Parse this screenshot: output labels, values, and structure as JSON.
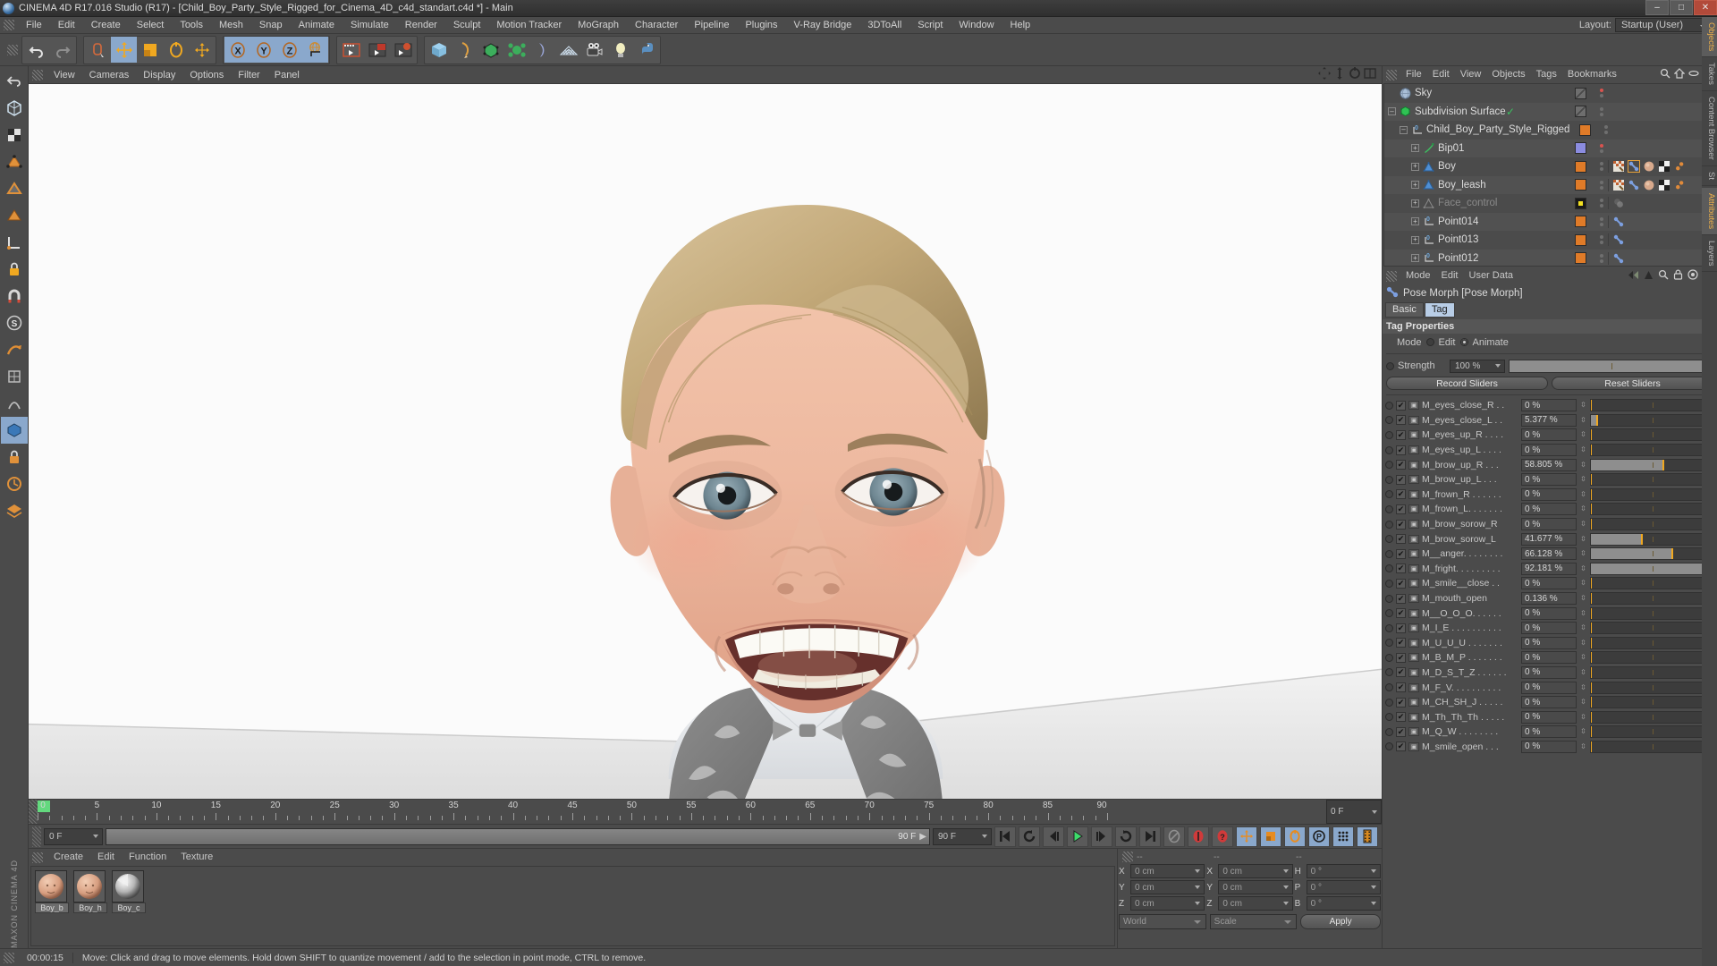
{
  "window": {
    "title": "CINEMA 4D R17.016 Studio (R17) - [Child_Boy_Party_Style_Rigged_for_Cinema_4D_c4d_standart.c4d *] - Main",
    "minimize": "–",
    "maximize": "□",
    "close": "✕"
  },
  "menubar": {
    "items": [
      "File",
      "Edit",
      "Create",
      "Select",
      "Tools",
      "Mesh",
      "Snap",
      "Animate",
      "Simulate",
      "Render",
      "Sculpt",
      "Motion Tracker",
      "MoGraph",
      "Character",
      "Pipeline",
      "Plugins",
      "V-Ray Bridge",
      "3DToAll",
      "Script",
      "Window",
      "Help"
    ],
    "layout_label": "Layout:",
    "layout_value": "Startup (User)"
  },
  "toolbar": {
    "groups": [
      {
        "name": "history",
        "buttons": [
          "undo-icon",
          "redo-icon"
        ]
      },
      {
        "name": "selection",
        "buttons": [
          "live-selection-icon",
          "move-icon",
          "scale-icon",
          "rotate-icon",
          "move-axis-icon"
        ]
      },
      {
        "name": "axis-lock",
        "buttons": [
          "x-axis-icon",
          "y-axis-icon",
          "z-axis-icon",
          "world-coord-icon"
        ]
      },
      {
        "name": "render",
        "buttons": [
          "render-view-icon",
          "render-region-icon",
          "render-settings-icon"
        ]
      },
      {
        "name": "objects",
        "buttons": [
          "cube-icon",
          "spline-pen-icon",
          "nurbs-icon",
          "array-icon",
          "deformer-icon",
          "floor-icon",
          "camera-icon",
          "light-icon",
          "python-icon"
        ]
      }
    ]
  },
  "left_tools": {
    "buttons": [
      "undo-nav-icon",
      "model-mode-icon",
      "texture-mode-icon",
      "points-mode-icon",
      "edges-mode-icon",
      "polygons-mode-icon",
      "axis-mode-icon",
      "lock-axis-icon",
      "magnet-icon",
      "snap-icon",
      "workplane-icon",
      "enable-axis-icon",
      "enable-deform-icon",
      "viewport-solo-icon",
      "render-lock-icon",
      "animation-lock-icon",
      "layer-lock-icon"
    ],
    "brand": "MAXON CINEMA 4D"
  },
  "viewport": {
    "menu": [
      "View",
      "Cameras",
      "Display",
      "Options",
      "Filter",
      "Panel"
    ],
    "nav_icons": [
      "pan-icon",
      "zoom-icon",
      "rotate-icon",
      "maximize-view-icon"
    ],
    "scene_caption": "Child boy character head with Pose Morph facial expression"
  },
  "timeline": {
    "ticks": [
      0,
      5,
      10,
      15,
      20,
      25,
      30,
      35,
      40,
      45,
      50,
      55,
      60,
      65,
      70,
      75,
      80,
      85,
      90
    ],
    "min": 0,
    "max": 90,
    "current_frame_green": 0,
    "end_frame_field": "0 F"
  },
  "transport": {
    "current_frame": "0 F",
    "preview_start": "0 F",
    "preview_end": "90 F",
    "doc_end": "90 F",
    "buttons": [
      "go-to-start-icon",
      "play-backwards-loop-icon",
      "step-back-icon",
      "play-icon",
      "step-forward-icon",
      "loop-icon",
      "go-to-end-icon",
      "autokey-icon",
      "record-icon",
      "keyframe-selection-icon"
    ],
    "modes": [
      "position-key-icon",
      "scale-key-icon",
      "rotation-key-icon",
      "param-key-icon",
      "point-level-anim-icon",
      "timeline-icon"
    ]
  },
  "material_manager": {
    "menu": [
      "Create",
      "Edit",
      "Function",
      "Texture"
    ],
    "materials": [
      {
        "name": "Boy_b",
        "type": "skin"
      },
      {
        "name": "Boy_h",
        "type": "skin"
      },
      {
        "name": "Boy_c",
        "type": "cloth"
      }
    ]
  },
  "coordinates": {
    "headers": [
      "--",
      "--",
      "--"
    ],
    "position": {
      "label_x": "X",
      "label_y": "Y",
      "label_z": "Z",
      "x": "0 cm",
      "y": "0 cm",
      "z": "0 cm"
    },
    "size": {
      "label_x": "X",
      "label_y": "Y",
      "label_z": "Z",
      "x": "0 cm",
      "y": "0 cm",
      "z": "0 cm"
    },
    "rotation": {
      "label_h": "H",
      "label_p": "P",
      "label_b": "B",
      "h": "0 °",
      "p": "0 °",
      "b": "0 °"
    },
    "coord_system": "World",
    "size_mode": "Scale",
    "apply_label": "Apply"
  },
  "object_manager": {
    "menu": [
      "File",
      "Edit",
      "View",
      "Objects",
      "Tags",
      "Bookmarks"
    ],
    "tools": [
      "search-icon",
      "home-icon",
      "filter-icon",
      "add-icon"
    ],
    "rows": [
      {
        "name": "Sky",
        "indent": 0,
        "icon": "sky-sphere-icon",
        "expander": "none",
        "color": "#6f6f6f",
        "swatch": "diagonal",
        "dots": [
          "red",
          "grey"
        ],
        "tags": [],
        "dim": false
      },
      {
        "name": "Subdivision Surface",
        "indent": 0,
        "icon": "subdivision-surface-icon",
        "expander": "minus",
        "color": "#36b24a",
        "swatch": "diagonal",
        "dots": [
          "grey",
          "grey"
        ],
        "check": true,
        "tags": [],
        "dim": false
      },
      {
        "name": "Child_Boy_Party_Style_Rigged",
        "indent": 1,
        "icon": "null-object-icon",
        "expander": "minus",
        "swatch": "#e07b28",
        "dots": [
          "grey",
          "grey"
        ],
        "tags": [],
        "dim": false
      },
      {
        "name": "Bip01",
        "indent": 2,
        "icon": "joint-icon",
        "expander": "plus",
        "swatch": "#8b8ce0",
        "dots": [
          "red",
          "grey"
        ],
        "tags": [],
        "dim": false
      },
      {
        "name": "Boy",
        "indent": 2,
        "icon": "polygon-object-icon",
        "expander": "plus",
        "swatch": "#e07b28",
        "dots": [
          "grey",
          "grey"
        ],
        "tags": [
          "weight-tag-icon",
          "posemorph-tag-icon",
          "texture-tag-icon",
          "uv-tag-icon",
          "selection-tag-icon"
        ],
        "dim": false,
        "tag_selected": 1
      },
      {
        "name": "Boy_leash",
        "indent": 2,
        "icon": "polygon-object-icon",
        "expander": "plus",
        "swatch": "#e07b28",
        "dots": [
          "grey",
          "grey"
        ],
        "tags": [
          "weight-tag-icon",
          "posemorph-tag-icon",
          "texture-tag-icon",
          "uv-tag-icon",
          "selection-tag-icon"
        ],
        "dim": false
      },
      {
        "name": "Face_control",
        "indent": 2,
        "icon": "polygon-object-icon",
        "expander": "plus",
        "swatch": "#f2e021",
        "dots": [
          "grey",
          "grey"
        ],
        "tags": [
          "material-tag-icon"
        ],
        "dim": true
      },
      {
        "name": "Point014",
        "indent": 2,
        "icon": "null-object-icon",
        "expander": "plus",
        "swatch": "#e07b28",
        "dots": [
          "grey",
          "grey"
        ],
        "tags": [
          "posemorph-tag-icon"
        ],
        "dim": false
      },
      {
        "name": "Point013",
        "indent": 2,
        "icon": "null-object-icon",
        "expander": "plus",
        "swatch": "#e07b28",
        "dots": [
          "grey",
          "grey"
        ],
        "tags": [
          "posemorph-tag-icon"
        ],
        "dim": false
      },
      {
        "name": "Point012",
        "indent": 2,
        "icon": "null-object-icon",
        "expander": "plus",
        "swatch": "#e07b28",
        "dots": [
          "grey",
          "grey"
        ],
        "tags": [
          "posemorph-tag-icon"
        ],
        "dim": false
      }
    ]
  },
  "attribute_manager": {
    "menu": [
      "Mode",
      "Edit",
      "User Data"
    ],
    "tools": [
      "back-icon",
      "forward-icon",
      "up-icon",
      "search-icon",
      "lock-icon",
      "target-icon",
      "add-icon"
    ],
    "object_title": "Pose Morph [Pose Morph]",
    "tabs": [
      {
        "label": "Basic",
        "active": false
      },
      {
        "label": "Tag",
        "active": true
      }
    ],
    "section": "Tag Properties",
    "mode_label": "Mode",
    "mode_options": [
      {
        "label": "Edit",
        "active": false
      },
      {
        "label": "Animate",
        "active": true
      }
    ],
    "strength": {
      "label": "Strength",
      "value": "100 %",
      "percent": 100
    },
    "record_label": "Record Sliders",
    "reset_label": "Reset Sliders",
    "sliders": [
      {
        "name": "M_eyes_close_R . .",
        "value": "0 %",
        "percent": 0
      },
      {
        "name": "M_eyes_close_L . .",
        "value": "5.377 %",
        "percent": 5.377
      },
      {
        "name": "M_eyes_up_R . . . .",
        "value": "0 %",
        "percent": 0
      },
      {
        "name": "M_eyes_up_L . . . .",
        "value": "0 %",
        "percent": 0
      },
      {
        "name": "M_brow_up_R . . .",
        "value": "58.805 %",
        "percent": 58.805
      },
      {
        "name": "M_brow_up_L . . .",
        "value": "0 %",
        "percent": 0
      },
      {
        "name": "M_frown_R . . . . . .",
        "value": "0 %",
        "percent": 0
      },
      {
        "name": "M_frown_L. . . . . . .",
        "value": "0 %",
        "percent": 0
      },
      {
        "name": "M_brow_sorow_R",
        "value": "0 %",
        "percent": 0
      },
      {
        "name": "M_brow_sorow_L",
        "value": "41.677 %",
        "percent": 41.677
      },
      {
        "name": "M__anger. . . . . . . .",
        "value": "66.128 %",
        "percent": 66.128
      },
      {
        "name": "M_fright. . . . . . . . .",
        "value": "92.181 %",
        "percent": 92.181
      },
      {
        "name": "M_smile__close . .",
        "value": "0 %",
        "percent": 0
      },
      {
        "name": "M_mouth_open",
        "value": "0.136 %",
        "percent": 0.136
      },
      {
        "name": "M__O_O_O. . . . . .",
        "value": "0 %",
        "percent": 0
      },
      {
        "name": "M_I_E . . . . . . . . . .",
        "value": "0 %",
        "percent": 0
      },
      {
        "name": "M_U_U_U . . . . . . .",
        "value": "0 %",
        "percent": 0
      },
      {
        "name": "M_B_M_P . . . . . . .",
        "value": "0 %",
        "percent": 0
      },
      {
        "name": "M_D_S_T_Z . . . . . .",
        "value": "0 %",
        "percent": 0
      },
      {
        "name": "M_F_V. . . . . . . . . .",
        "value": "0 %",
        "percent": 0
      },
      {
        "name": "M_CH_SH_J . . . . .",
        "value": "0 %",
        "percent": 0
      },
      {
        "name": "M_Th_Th_Th . . . . .",
        "value": "0 %",
        "percent": 0
      },
      {
        "name": "M_Q_W . . . . . . . .",
        "value": "0 %",
        "percent": 0
      },
      {
        "name": "M_smile_open . . .",
        "value": "0 %",
        "percent": 0
      }
    ]
  },
  "right_tabs": [
    "Objects",
    "Takes",
    "Content Browser",
    "St"
  ],
  "right_tabs_2": [
    "Attributes",
    "Layers"
  ],
  "far_right_tabs": [
    "Objects",
    "Content Browser",
    "Layers"
  ],
  "statusbar": {
    "time": "00:00:15",
    "message": "Move: Click and drag to move elements. Hold down SHIFT to quantize movement / add to the selection in point mode, CTRL to remove."
  },
  "colors": {
    "accent_orange": "#f0a820",
    "panel_bg": "#4b4b4b",
    "field_bg": "#3f3f3f",
    "active_blue": "#8aa8cc",
    "green": "#36b24a"
  }
}
